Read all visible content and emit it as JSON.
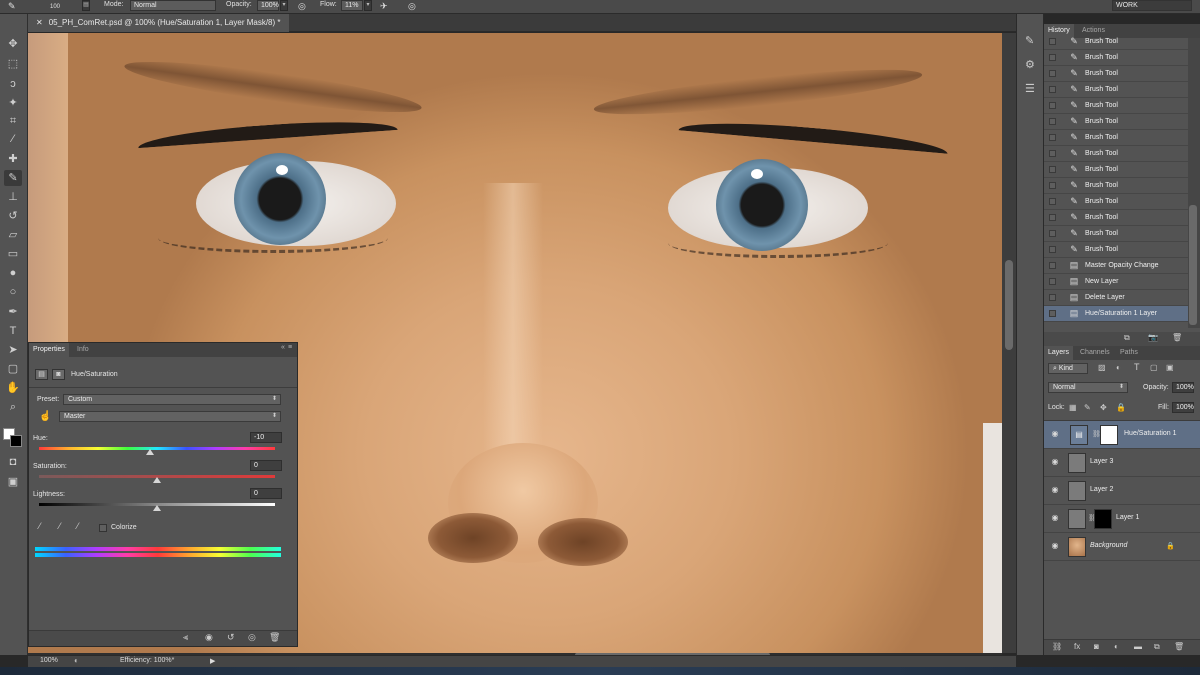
{
  "options_bar": {
    "brush_size": "100",
    "mode_label": "Mode:",
    "mode_value": "Normal",
    "opacity_label": "Opacity:",
    "opacity_value": "100%",
    "flow_label": "Flow:",
    "flow_value": "11%",
    "workspace": "WORK"
  },
  "document": {
    "tab_title": "05_PH_ComRet.psd @ 100% (Hue/Saturation 1, Layer Mask/8) *"
  },
  "status_bar": {
    "zoom": "100%",
    "info": "Efficiency: 100%*"
  },
  "properties_panel": {
    "tabs": [
      "Properties",
      "Info"
    ],
    "adjustment_title": "Hue/Saturation",
    "preset_label": "Preset:",
    "preset_value": "Custom",
    "channel_value": "Master",
    "hue_label": "Hue:",
    "hue_value": "-10",
    "hue_level": -10,
    "saturation_label": "Saturation:",
    "saturation_value": "0",
    "saturation_level": 0,
    "lightness_label": "Lightness:",
    "lightness_value": "0",
    "lightness_level": 0,
    "colorize_label": "Colorize",
    "colorize_checked": false
  },
  "history_panel": {
    "tabs": [
      "History",
      "Actions"
    ],
    "items": [
      {
        "label": "Brush Tool",
        "icon": "brush-icon"
      },
      {
        "label": "Brush Tool",
        "icon": "brush-icon"
      },
      {
        "label": "Brush Tool",
        "icon": "brush-icon"
      },
      {
        "label": "Brush Tool",
        "icon": "brush-icon"
      },
      {
        "label": "Brush Tool",
        "icon": "brush-icon"
      },
      {
        "label": "Brush Tool",
        "icon": "brush-icon"
      },
      {
        "label": "Brush Tool",
        "icon": "brush-icon"
      },
      {
        "label": "Brush Tool",
        "icon": "brush-icon"
      },
      {
        "label": "Brush Tool",
        "icon": "brush-icon"
      },
      {
        "label": "Brush Tool",
        "icon": "brush-icon"
      },
      {
        "label": "Brush Tool",
        "icon": "brush-icon"
      },
      {
        "label": "Brush Tool",
        "icon": "brush-icon"
      },
      {
        "label": "Brush Tool",
        "icon": "brush-icon"
      },
      {
        "label": "Brush Tool",
        "icon": "brush-icon"
      },
      {
        "label": "Master Opacity Change",
        "icon": "document-icon"
      },
      {
        "label": "New Layer",
        "icon": "document-icon"
      },
      {
        "label": "Delete Layer",
        "icon": "document-icon"
      },
      {
        "label": "Hue/Saturation 1 Layer",
        "icon": "document-icon",
        "selected": true
      }
    ]
  },
  "layers_panel": {
    "tabs": [
      "Layers",
      "Channels",
      "Paths"
    ],
    "filter_kind": "Kind",
    "blend_mode": "Normal",
    "opacity_label": "Opacity:",
    "opacity_value": "100%",
    "lock_label": "Lock:",
    "fill_label": "Fill:",
    "fill_value": "100%",
    "layers": [
      {
        "name": "Hue/Saturation 1",
        "selected": true
      },
      {
        "name": "Layer 3"
      },
      {
        "name": "Layer 2"
      },
      {
        "name": "Layer 1"
      },
      {
        "name": "Background",
        "locked": true
      }
    ]
  },
  "colors": {
    "selection": "#5f6f86",
    "panel": "#535353"
  }
}
